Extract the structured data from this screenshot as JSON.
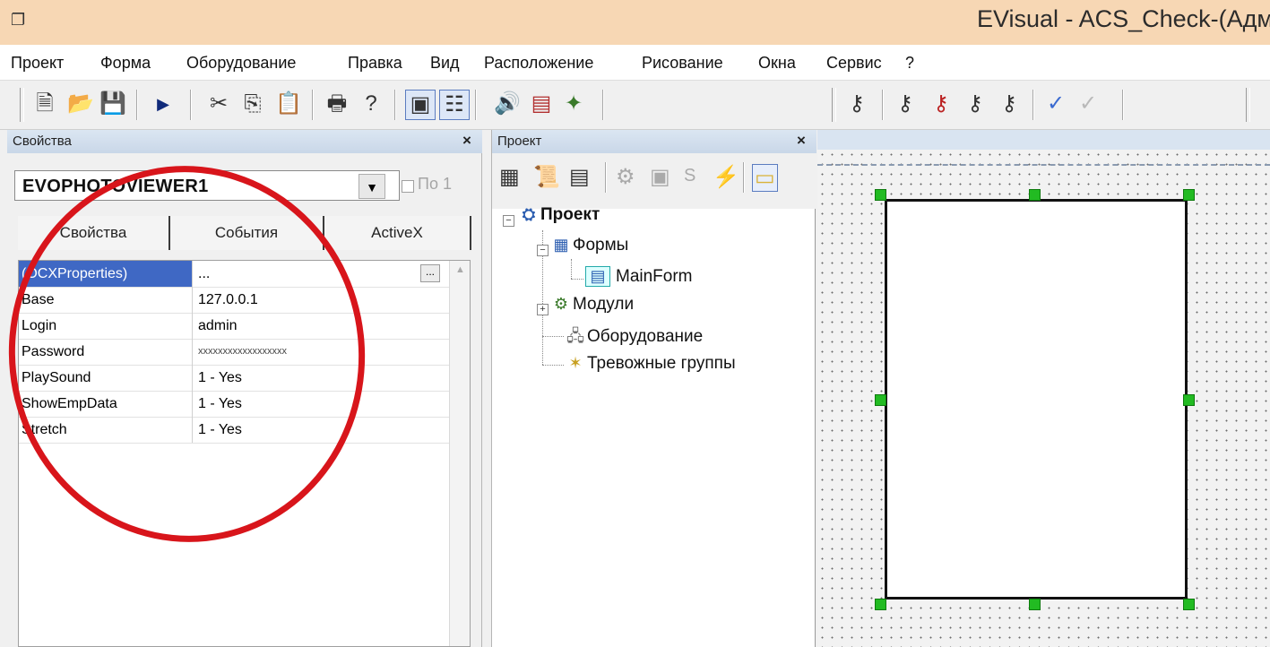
{
  "window": {
    "title": "EVisual - ACS_Check-(Адм"
  },
  "menu": [
    "Проект",
    "Форма",
    "Оборудование",
    "Правка",
    "Вид",
    "Расположение",
    "Рисование",
    "Окна",
    "Сервис",
    "?"
  ],
  "toolbar": {
    "icons": [
      "new-icon",
      "open-icon",
      "save-icon",
      "run-icon",
      "cut-icon",
      "copy-icon",
      "paste-icon",
      "print-icon",
      "help-icon",
      "view-toggle-icon",
      "properties-icon",
      "sound-icon",
      "list-icon",
      "puzzle-icon",
      "key-icon",
      "key-pair-icon",
      "key-delete-icon",
      "key-copy-icon",
      "key-search-icon",
      "check-icon",
      "check-disabled-icon"
    ]
  },
  "properties_panel": {
    "title": "Свойства",
    "close": "×",
    "object": "EVOPHOTOVIEWER1",
    "checkbox_label": "По 1",
    "tabs": [
      "Свойства",
      "События",
      "ActiveX"
    ],
    "rows": [
      {
        "name": "(OCXProperties)",
        "value": "..."
      },
      {
        "name": "Base",
        "value": "127.0.0.1"
      },
      {
        "name": "Login",
        "value": "admin"
      },
      {
        "name": "Password",
        "value": "xxxxxxxxxxxxxxxxxx"
      },
      {
        "name": "PlaySound",
        "value": "1 - Yes"
      },
      {
        "name": "ShowEmpData",
        "value": "1 - Yes"
      },
      {
        "name": "Stretch",
        "value": "1 - Yes"
      }
    ],
    "ellipsis": "..."
  },
  "project_panel": {
    "title": "Проект",
    "close": "×",
    "tool_s": "S",
    "tree": {
      "root": "Проект",
      "forms": "Формы",
      "main_form": "MainForm",
      "modules": "Модули",
      "equipment": "Оборудование",
      "alarm_groups": "Тревожные группы"
    }
  },
  "accent": {
    "annotation": "#d8151b",
    "handles": "#22bb22",
    "selection": "#3f68c4"
  }
}
